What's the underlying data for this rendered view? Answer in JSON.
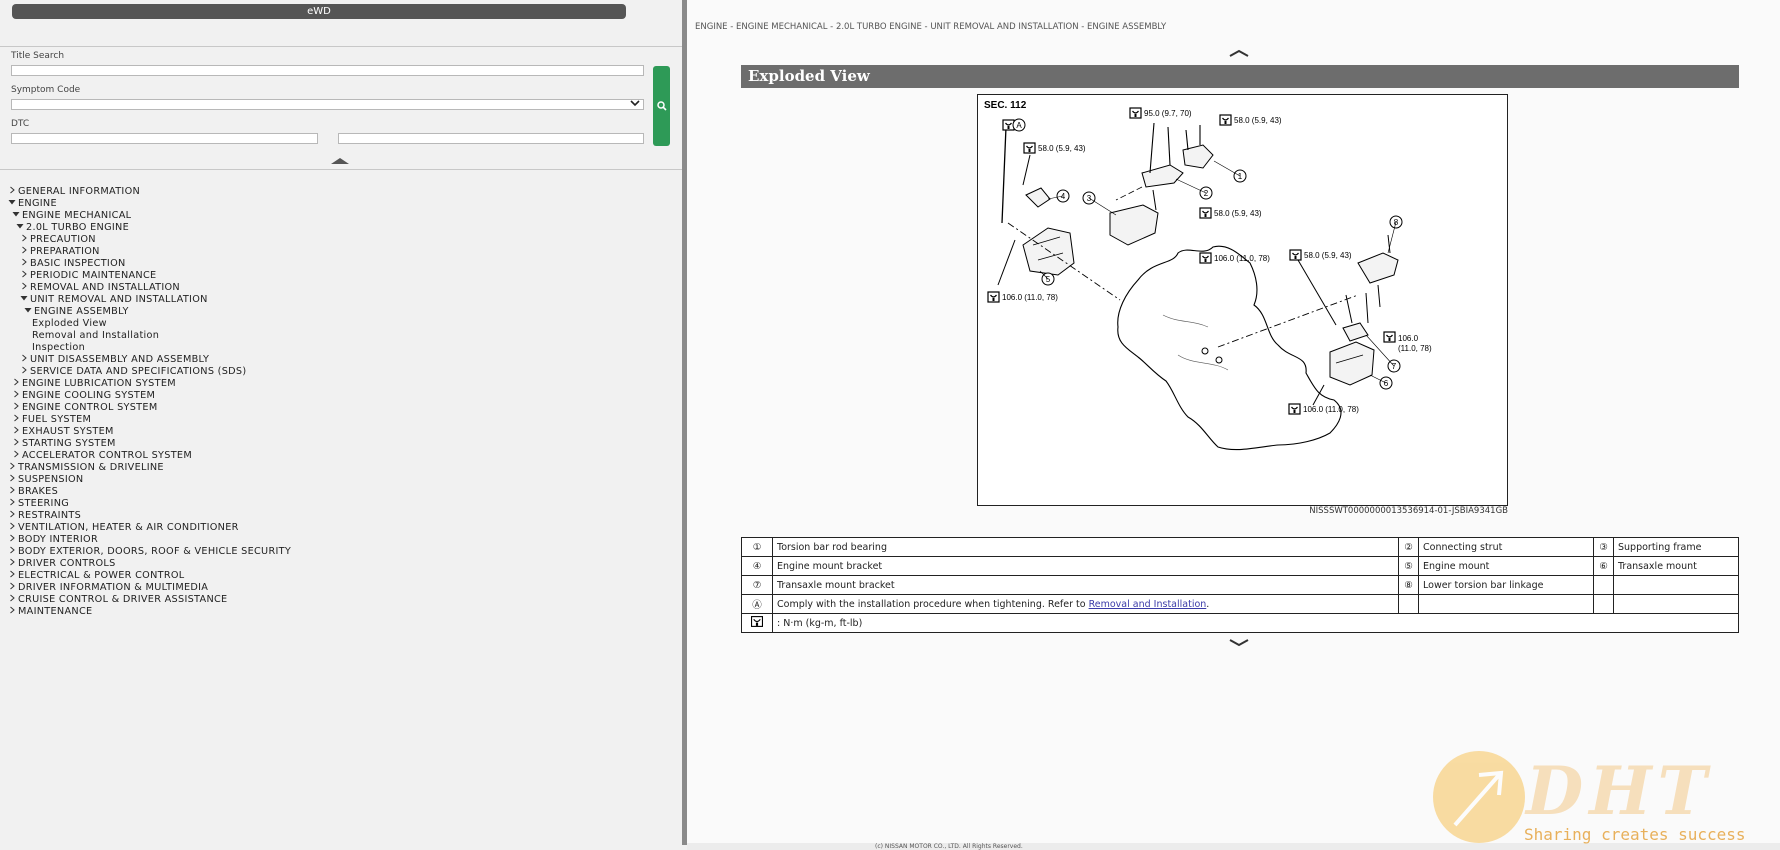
{
  "app": {
    "title": "eWD"
  },
  "search": {
    "title_label": "Title Search",
    "symptom_label": "Symptom Code",
    "dtc_label": "DTC"
  },
  "tree": [
    {
      "label": "GENERAL INFORMATION",
      "level": 0,
      "state": "collapsed"
    },
    {
      "label": "ENGINE",
      "level": 0,
      "state": "expanded"
    },
    {
      "label": "ENGINE MECHANICAL",
      "level": 1,
      "state": "expanded"
    },
    {
      "label": "2.0L TURBO ENGINE",
      "level": 2,
      "state": "expanded"
    },
    {
      "label": "PRECAUTION",
      "level": 3,
      "state": "collapsed"
    },
    {
      "label": "PREPARATION",
      "level": 3,
      "state": "collapsed"
    },
    {
      "label": "BASIC INSPECTION",
      "level": 3,
      "state": "collapsed"
    },
    {
      "label": "PERIODIC MAINTENANCE",
      "level": 3,
      "state": "collapsed"
    },
    {
      "label": "REMOVAL AND INSTALLATION",
      "level": 3,
      "state": "collapsed"
    },
    {
      "label": "UNIT REMOVAL AND INSTALLATION",
      "level": 3,
      "state": "expanded"
    },
    {
      "label": "ENGINE ASSEMBLY",
      "level": 4,
      "state": "expanded"
    },
    {
      "label": "Exploded View",
      "level": 5,
      "state": "leaf"
    },
    {
      "label": "Removal and Installation",
      "level": 5,
      "state": "leaf"
    },
    {
      "label": "Inspection",
      "level": 5,
      "state": "leaf"
    },
    {
      "label": "UNIT DISASSEMBLY AND ASSEMBLY",
      "level": 3,
      "state": "collapsed"
    },
    {
      "label": "SERVICE DATA AND SPECIFICATIONS (SDS)",
      "level": 3,
      "state": "collapsed"
    },
    {
      "label": "ENGINE LUBRICATION SYSTEM",
      "level": 1,
      "state": "collapsed"
    },
    {
      "label": "ENGINE COOLING SYSTEM",
      "level": 1,
      "state": "collapsed"
    },
    {
      "label": "ENGINE CONTROL SYSTEM",
      "level": 1,
      "state": "collapsed"
    },
    {
      "label": "FUEL SYSTEM",
      "level": 1,
      "state": "collapsed"
    },
    {
      "label": "EXHAUST SYSTEM",
      "level": 1,
      "state": "collapsed"
    },
    {
      "label": "STARTING SYSTEM",
      "level": 1,
      "state": "collapsed"
    },
    {
      "label": "ACCELERATOR CONTROL SYSTEM",
      "level": 1,
      "state": "collapsed"
    },
    {
      "label": "TRANSMISSION & DRIVELINE",
      "level": 0,
      "state": "collapsed"
    },
    {
      "label": "SUSPENSION",
      "level": 0,
      "state": "collapsed"
    },
    {
      "label": "BRAKES",
      "level": 0,
      "state": "collapsed"
    },
    {
      "label": "STEERING",
      "level": 0,
      "state": "collapsed"
    },
    {
      "label": "RESTRAINTS",
      "level": 0,
      "state": "collapsed"
    },
    {
      "label": "VENTILATION, HEATER & AIR CONDITIONER",
      "level": 0,
      "state": "collapsed"
    },
    {
      "label": "BODY INTERIOR",
      "level": 0,
      "state": "collapsed"
    },
    {
      "label": "BODY EXTERIOR, DOORS, ROOF & VEHICLE SECURITY",
      "level": 0,
      "state": "collapsed"
    },
    {
      "label": "DRIVER CONTROLS",
      "level": 0,
      "state": "collapsed"
    },
    {
      "label": "ELECTRICAL & POWER CONTROL",
      "level": 0,
      "state": "collapsed"
    },
    {
      "label": "DRIVER INFORMATION & MULTIMEDIA",
      "level": 0,
      "state": "collapsed"
    },
    {
      "label": "CRUISE CONTROL & DRIVER ASSISTANCE",
      "level": 0,
      "state": "collapsed"
    },
    {
      "label": "MAINTENANCE",
      "level": 0,
      "state": "collapsed"
    }
  ],
  "content": {
    "breadcrumb": "ENGINE - ENGINE MECHANICAL - 2.0L TURBO ENGINE - UNIT REMOVAL AND INSTALLATION - ENGINE ASSEMBLY",
    "section_title": "Exploded View",
    "figure": {
      "section": "SEC. 112",
      "torques": [
        "95.0 (9.7, 70)",
        "58.0 (5.9, 43)",
        "58.0 (5.9, 43)",
        "58.0 (5.9, 43)",
        "58.0 (5.9, 43)",
        "106.0 (11.0, 78)",
        "106.0 (11.0, 78)",
        "106.0",
        "(11.0, 78)",
        "106.0 (11.0, 78)"
      ],
      "callouts": [
        "1",
        "2",
        "3",
        "4",
        "5",
        "6",
        "7",
        "8"
      ],
      "marker_a": "A",
      "id": "NISSSWT0000000013536914-01-JSBIA9341GB"
    },
    "legend": {
      "r1": [
        "①",
        "Torsion bar rod bearing",
        "②",
        "Connecting strut",
        "③",
        "Supporting frame"
      ],
      "r2": [
        "④",
        "Engine mount bracket",
        "⑤",
        "Engine mount",
        "⑥",
        "Transaxle mount"
      ],
      "r3": [
        "⑦",
        "Transaxle mount bracket",
        "⑧",
        "Lower torsion bar linkage"
      ],
      "r4_sym": "Ⓐ",
      "r4_text": "Comply with the installation procedure when tightening. Refer to ",
      "r4_link": "Removal and Installation",
      "r4_end": ".",
      "r5_text": ": N·m (kg-m, ft-lb)"
    },
    "copyright": "(c) NISSAN MOTOR CO., LTD. All Rights Reserved."
  },
  "watermark": {
    "text": "DHT",
    "tagline": "Sharing creates success"
  }
}
